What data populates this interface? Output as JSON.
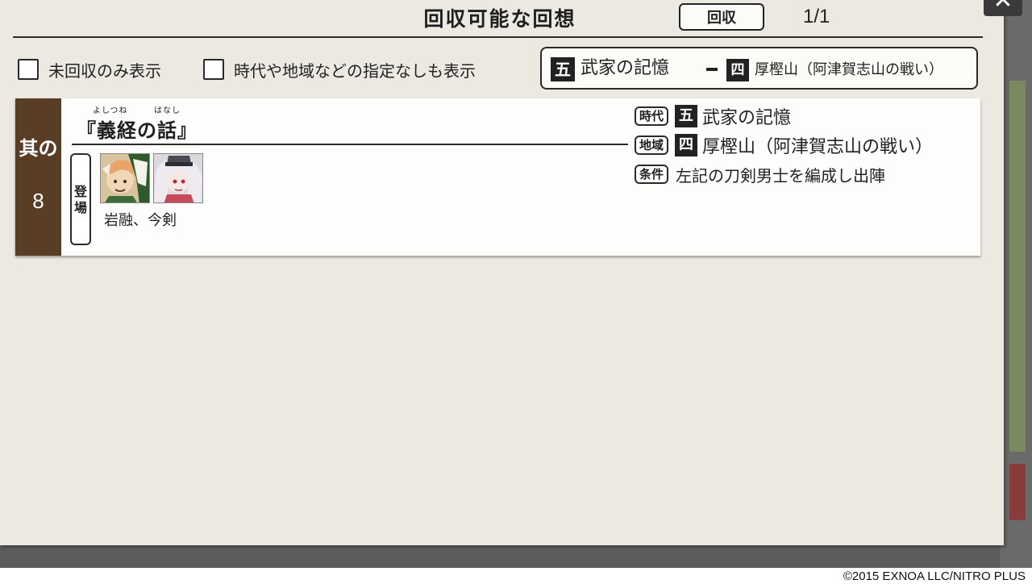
{
  "header": {
    "title": "回収可能な回想",
    "collect_button": "回収",
    "page_indicator": "1/1",
    "close_icon": "close-icon",
    "close_glyph": "✕"
  },
  "filters": {
    "unrecovered_only": {
      "label": "未回収のみ表示",
      "checked": false
    },
    "show_unspecified": {
      "label": "時代や地域などの指定なしも表示",
      "checked": false
    },
    "era_badge": "五",
    "era": "武家の記憶",
    "region_badge": "四",
    "region": "厚樫山（阿津賀志山の戦い）"
  },
  "cards": [
    {
      "number_label": "其の",
      "number": "8",
      "ruby_1": "よしつね",
      "ruby_2": "はなし",
      "title": "『義経の話』",
      "appear_tag": "登場",
      "characters": "岩融、今剣",
      "era_tag": "時代",
      "era_badge": "五",
      "era": "武家の記憶",
      "region_tag": "地域",
      "region_badge": "四",
      "region": "厚樫山（阿津賀志山の戦い）",
      "condition_tag": "条件",
      "condition": "左記の刀剣男士を編成し出陣"
    }
  ],
  "footer": {
    "copyright": "©2015 EXNOA LLC/NITRO PLUS"
  },
  "colors": {
    "panel_bg": "#ece9e2",
    "card_number_bg": "#5a3d25",
    "ink": "#222222"
  }
}
